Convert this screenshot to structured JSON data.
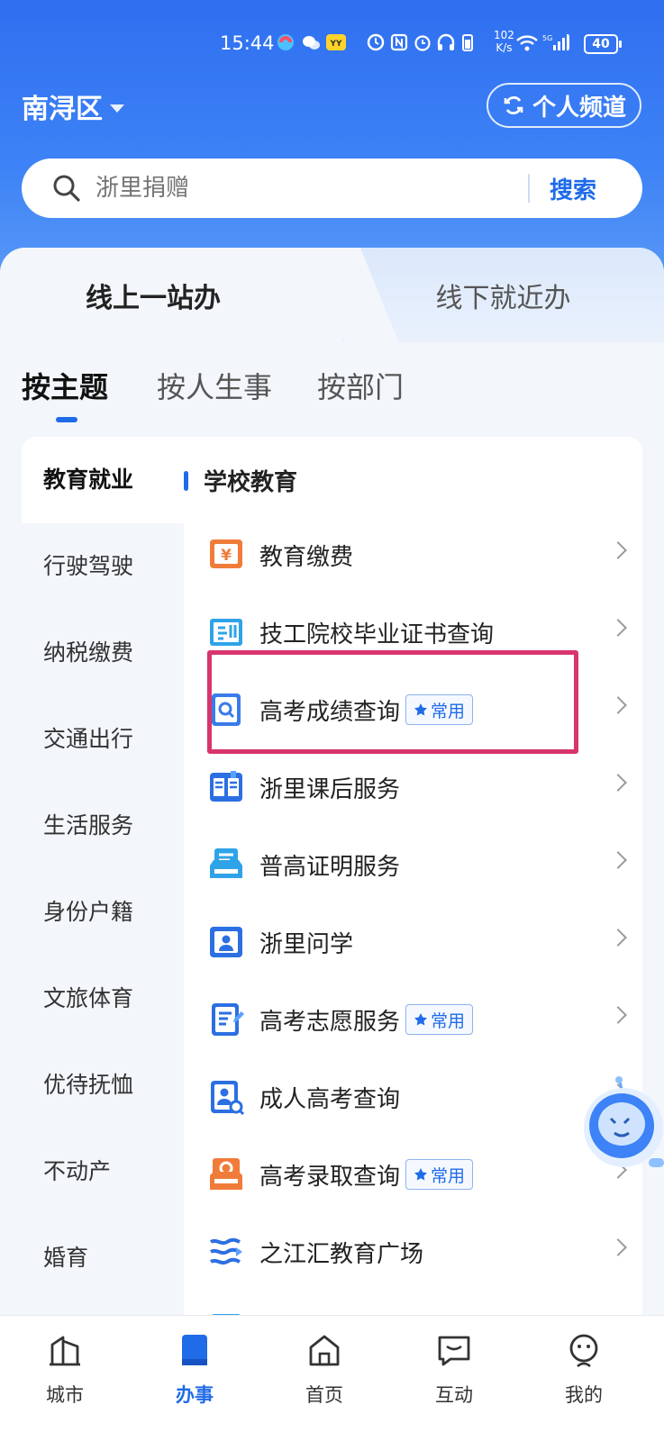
{
  "status_bar": {
    "time": "15:44",
    "net_speed": "102\nK/s",
    "battery": "40"
  },
  "header": {
    "district": "南浔区",
    "channel_button": "个人频道"
  },
  "search": {
    "placeholder": "浙里捐赠",
    "button": "搜索"
  },
  "top_tabs": {
    "active": "线上一站办",
    "inactive": "线下就近办"
  },
  "sub_tabs": [
    "按主题",
    "按人生事",
    "按部门"
  ],
  "categories": [
    "教育就业",
    "行驶驾驶",
    "纳税缴费",
    "交通出行",
    "生活服务",
    "身份户籍",
    "文旅体育",
    "优待抚恤",
    "不动产",
    "婚育"
  ],
  "section_title": "学校教育",
  "badge_text": "常用",
  "services": [
    {
      "label": "教育缴费",
      "badge": ""
    },
    {
      "label": "技工院校毕业证书查询",
      "badge": ""
    },
    {
      "label": "高考成绩查询",
      "badge": "常用"
    },
    {
      "label": "浙里课后服务",
      "badge": ""
    },
    {
      "label": "普高证明服务",
      "badge": ""
    },
    {
      "label": "浙里问学",
      "badge": ""
    },
    {
      "label": "高考志愿服务",
      "badge": "常用"
    },
    {
      "label": "成人高考查询",
      "badge": ""
    },
    {
      "label": "高考录取查询",
      "badge": "常用"
    },
    {
      "label": "之江汇教育广场",
      "badge": ""
    }
  ],
  "bottom_nav": [
    "城市",
    "办事",
    "首页",
    "互动",
    "我的"
  ],
  "active_nav": "办事",
  "colors": {
    "brand_blue": "#1f6be8",
    "highlight": "#d8356f",
    "orange": "#f07c3a"
  }
}
